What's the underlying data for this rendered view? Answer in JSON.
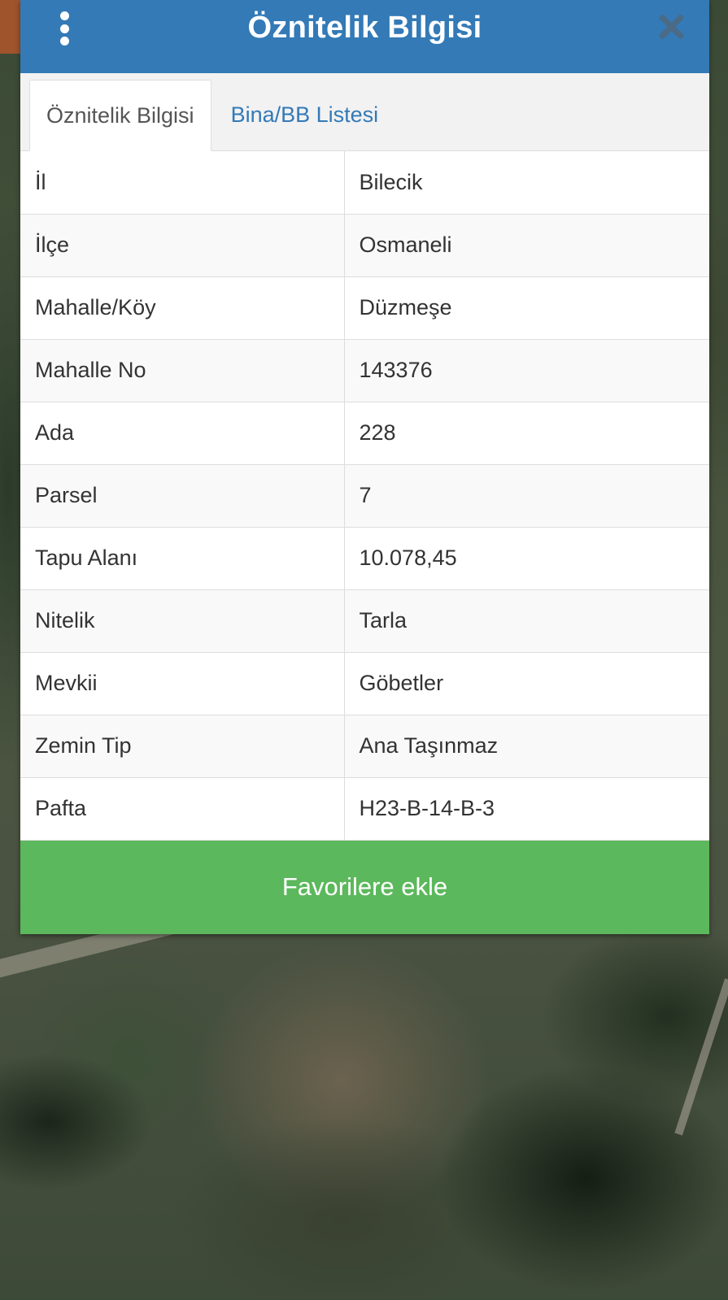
{
  "dialog": {
    "title": "Öznitelik Bilgisi",
    "menu_icon": "more-vertical-icon",
    "close_icon": "close-icon"
  },
  "tabs": [
    {
      "label": "Öznitelik Bilgisi",
      "active": true
    },
    {
      "label": "Bina/BB Listesi",
      "active": false
    }
  ],
  "rows": [
    {
      "key": "İl",
      "value": "Bilecik"
    },
    {
      "key": "İlçe",
      "value": "Osmaneli"
    },
    {
      "key": "Mahalle/Köy",
      "value": "Düzmeşe"
    },
    {
      "key": "Mahalle No",
      "value": "143376"
    },
    {
      "key": "Ada",
      "value": "228"
    },
    {
      "key": "Parsel",
      "value": "7"
    },
    {
      "key": "Tapu Alanı",
      "value": "10.078,45"
    },
    {
      "key": "Nitelik",
      "value": "Tarla"
    },
    {
      "key": "Mevkii",
      "value": "Göbetler"
    },
    {
      "key": "Zemin Tip",
      "value": "Ana Taşınmaz"
    },
    {
      "key": "Pafta",
      "value": "H23-B-14-B-3"
    }
  ],
  "actions": {
    "favorite_label": "Favorilere ekle"
  },
  "colors": {
    "header": "#337ab7",
    "success": "#5cb85c",
    "link": "#337ab7"
  }
}
